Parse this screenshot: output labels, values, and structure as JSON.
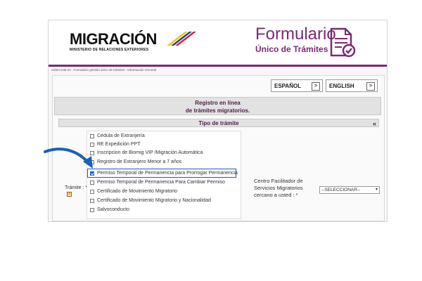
{
  "header": {
    "logo_title": "MIGRACIÓN",
    "logo_subtitle": "MINISTERIO DE RELACIONES EXTERIORES",
    "form_title_line1": "Formulario",
    "form_title_line2": "Único de Trámites"
  },
  "breadcrumb": "Usted está en : Formulario gestión único de trámites › Información General",
  "languages": {
    "spanish": "ESPAÑOL",
    "english": "ENGLISH",
    "go": ">"
  },
  "registro": {
    "line1": "Registro en línea",
    "line2": "de trámites migratorios."
  },
  "tipo_tramite": {
    "title": "Tipo de trámite",
    "collapse": "«"
  },
  "tramite_label": "Trámite : *",
  "options": [
    {
      "label": "Cédula de Extranjería",
      "checked": false
    },
    {
      "label": "RE Expedición PPT",
      "checked": false
    },
    {
      "label": "Inscripcion de Biomig VIP /Migración Automática",
      "checked": false
    },
    {
      "label": "Registro de Extranjero Menor a 7 años",
      "checked": false
    },
    {
      "label": "Permiso Temporal de Permanencia para Prorrogar Permanencia",
      "checked": true
    },
    {
      "label": "Permiso Temporal de Permanencia Para Cambiar Permiso",
      "checked": false
    },
    {
      "label": "Certificado de Movimiento Migratorio",
      "checked": false
    },
    {
      "label": "Certificado de Movimiento Migratorio y Nacionalidad",
      "checked": false
    },
    {
      "label": "Salvoconducto",
      "checked": false
    }
  ],
  "centro": {
    "label": "Centro Facilitador de Servicios Migratorios cercano a usted : *",
    "selected": "--SELECCIONAR--"
  },
  "colors": {
    "brand_purple": "#7a2a73",
    "highlight_blue": "#1c5fb8"
  }
}
